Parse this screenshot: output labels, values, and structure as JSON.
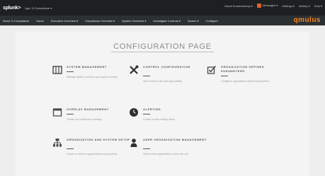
{
  "topbar": {
    "logo": "splunk>",
    "app": "App: G-Compliance ▾",
    "user": "Gaurli Kumbharkoop ▾",
    "messages": "Messages ▾",
    "settings": "Settings ▾",
    "activity": "Activity ▾",
    "help": "Help ▾"
  },
  "nav": {
    "items": [
      "About G-Compliance",
      "Home",
      "Executive Overview ▾",
      "Compliance Overview ▾",
      "System Overview ▾",
      "Investigate Controls ▾",
      "Search ▾",
      "Configure"
    ],
    "brand": "qmulus"
  },
  "page": {
    "title": "CONFIGURATION PAGE"
  },
  "cards": [
    {
      "title": "SYSTEM MANAGEMENT",
      "desc": "Manage system columns and apply inventory",
      "icon": "columns-icon"
    },
    {
      "title": "CONTROL CONFIGURATION",
      "desc": "View control rules and applicability",
      "icon": "tools-icon"
    },
    {
      "title": "ORGANIZATION DEFINED PARAMETERS",
      "desc": "Configure organization defined parameters",
      "icon": "checkbox-edit-icon"
    },
    {
      "title": "OVERLAY MANAGEMENT",
      "desc": "Create and customize overlays",
      "icon": "window-icon"
    },
    {
      "title": "ALERTING",
      "desc": "Create or edit existing alerts",
      "icon": "clock-icon"
    },
    {
      "title": "ORGANIZATION AND SYSTEM SETUP",
      "desc": "Create or remove organizations and systems",
      "icon": "hierarchy-icon"
    },
    {
      "title": "USER ORGANIZATION MANAGEMENT",
      "desc": "Select what organizations users can see",
      "icon": "user-icon"
    }
  ],
  "colors": {
    "topbar": "#1d1f21",
    "navbar": "#2b3033",
    "brand": "#f58220",
    "background": "#eeeeee"
  }
}
